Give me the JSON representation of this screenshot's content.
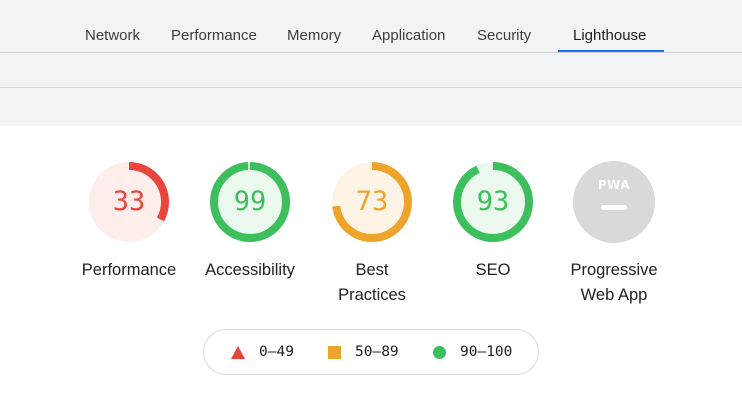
{
  "tabs": [
    {
      "label": "Network"
    },
    {
      "label": "Performance"
    },
    {
      "label": "Memory"
    },
    {
      "label": "Application"
    },
    {
      "label": "Security"
    },
    {
      "label": "Lighthouse"
    }
  ],
  "active_tab": "Lighthouse",
  "gauges": [
    {
      "score": "33",
      "label_lines": [
        "Performance"
      ],
      "fraction": 0.33,
      "status": "fail",
      "color": "#e8453c",
      "bg": "#fdeeec"
    },
    {
      "score": "99",
      "label_lines": [
        "Accessibility"
      ],
      "fraction": 0.99,
      "status": "pass",
      "color": "#3cbf5c",
      "bg": "#eaf8ee"
    },
    {
      "score": "73",
      "label_lines": [
        "Best",
        "Practices"
      ],
      "fraction": 0.73,
      "status": "average",
      "color": "#eea32b",
      "bg": "#fef4e6"
    },
    {
      "score": "93",
      "label_lines": [
        "SEO"
      ],
      "fraction": 0.93,
      "status": "pass",
      "color": "#3cbf5c",
      "bg": "#eaf8ee"
    },
    {
      "score": "",
      "label_lines": [
        "Progressive",
        "Web App"
      ],
      "badge": "PWA",
      "status": "not-applicable",
      "color": "#d9d9d9"
    }
  ],
  "legend": [
    {
      "range": "0–49",
      "icon": "triangle-icon",
      "color": "#e8453c"
    },
    {
      "range": "50–89",
      "icon": "square-icon",
      "color": "#eea32b"
    },
    {
      "range": "90–100",
      "icon": "circle-icon",
      "color": "#3cbf5c"
    }
  ]
}
